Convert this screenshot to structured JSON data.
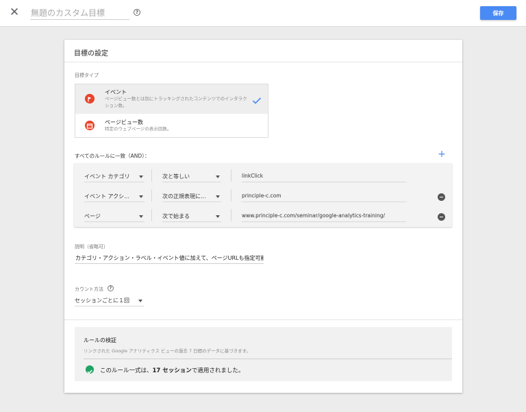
{
  "header": {
    "close_icon": "close-icon",
    "title_placeholder": "無題のカスタム目標",
    "help": "?",
    "save_label": "保存"
  },
  "colors": {
    "accent": "#4a8af4",
    "event_icon": "#e8432a",
    "success": "#1fa463"
  },
  "card": {
    "title": "目標の設定",
    "goal_type_label": "目標タイプ",
    "goal_types": [
      {
        "label": "イベント",
        "description": "ページビュー数とは別にトラッキングされたコンテンツでのインタラクション数。",
        "icon": "flag-icon",
        "selected": true
      },
      {
        "label": "ページビュー数",
        "description": "特定のウェブページの表示回数。",
        "icon": "page-icon",
        "selected": false
      }
    ],
    "rules_label": "すべてのルールに一致（AND）：",
    "rules": [
      {
        "dimension": "イベント カテゴリ",
        "operator": "次と等しい",
        "value": "linkClick"
      },
      {
        "dimension": "イベント アクシ...",
        "operator": "次の正規表現に...",
        "value": "principle-c.com"
      },
      {
        "dimension": "ページ",
        "operator": "次で始まる",
        "value": "www.principle-c.com/seminar/google-analytics-training/"
      }
    ],
    "description_label": "説明（省略可）",
    "description_value": "カテゴリ・アクション・ラベル・イベント値に加えて、ページURLも指定可能",
    "count_label": "カウント方法",
    "count_help": "?",
    "count_value": "セッションごとに１回",
    "verify": {
      "title": "ルールの検証",
      "description": "リンクされた Google アナリティクス ビューの過去 7 日間のデータに基づきます。",
      "result_prefix": "このルール一式は、",
      "result_count": "17 セッション",
      "result_suffix": "で適用されました。"
    }
  }
}
